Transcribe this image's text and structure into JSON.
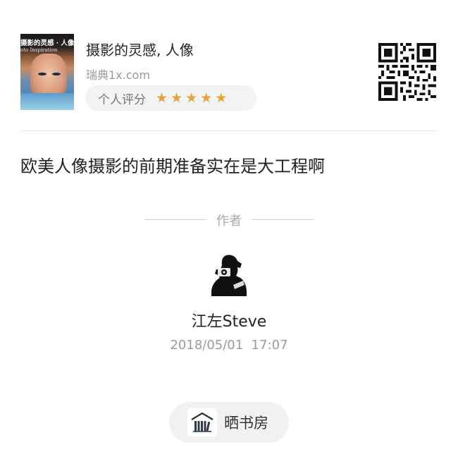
{
  "book": {
    "cover_title": "摄影的灵感 · 人像",
    "cover_subtitle": "oto Inspiration",
    "title": "摄影的灵感, 人像",
    "source": "瑞典1x.com",
    "rating_label": "个人评分",
    "rating_stars": 5,
    "star_color": "#e6a33a"
  },
  "quote": "欧美人像摄影的前期准备实在是大工程啊",
  "author": {
    "heading": "作者",
    "name": "江左Steve",
    "date": "2018/05/01  17:07"
  },
  "bookshelf": {
    "label": "晒书房",
    "icon": "bookshelf-icon"
  },
  "icons": {
    "qr": "qr-code-icon",
    "star": "star-icon",
    "avatar": "photographer-avatar"
  }
}
